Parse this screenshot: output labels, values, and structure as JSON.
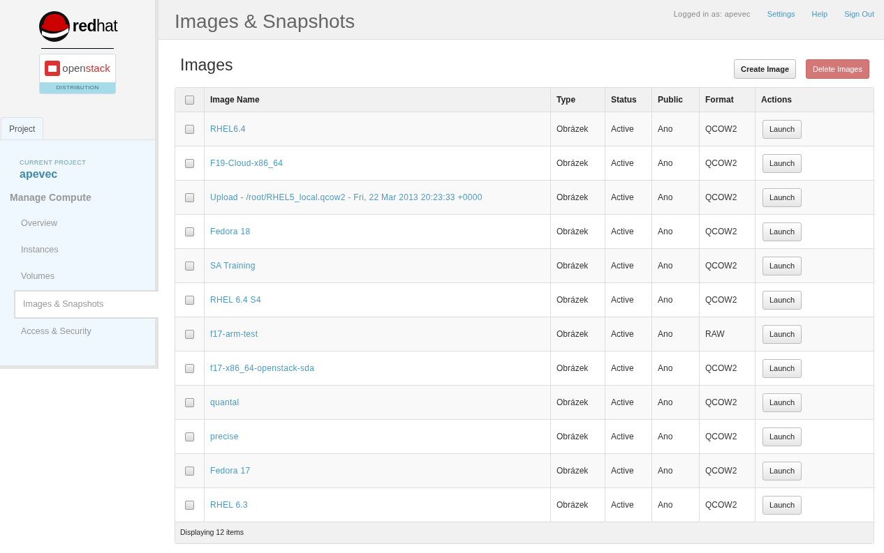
{
  "brand": {
    "logo_text_bold": "red",
    "logo_text": "hat",
    "sub_logo_left": "open",
    "sub_logo_right": "stack",
    "sub_logo_banner": "DISTRIBUTION"
  },
  "sidebar": {
    "tabs": [
      {
        "label": "Project",
        "selected": true
      }
    ],
    "current_project_label": "CURRENT PROJECT",
    "current_project": "apevec",
    "section": "Manage Compute",
    "items": [
      {
        "label": "Overview",
        "selected": false
      },
      {
        "label": "Instances",
        "selected": false
      },
      {
        "label": "Volumes",
        "selected": false
      },
      {
        "label": "Images & Snapshots",
        "selected": true
      },
      {
        "label": "Access & Security",
        "selected": false
      }
    ]
  },
  "header": {
    "title": "Images & Snapshots",
    "logged_in": "Logged in as: apevec",
    "links": [
      "Settings",
      "Help",
      "Sign Out"
    ]
  },
  "panel": {
    "title": "Images",
    "buttons": [
      {
        "label": "Create Image",
        "kind": "default"
      },
      {
        "label": "Delete Images",
        "kind": "danger"
      }
    ]
  },
  "table": {
    "columns": [
      "Image Name",
      "Type",
      "Status",
      "Public",
      "Format",
      "Actions"
    ],
    "select_all_checked": false,
    "rows": [
      {
        "name": "RHEL6.4",
        "type": "Obrázek",
        "status": "Active",
        "public": "Ano",
        "format": "QCOW2",
        "action": "Launch",
        "checked": false
      },
      {
        "name": "F19-Cloud-x86_64",
        "type": "Obrázek",
        "status": "Active",
        "public": "Ano",
        "format": "QCOW2",
        "action": "Launch",
        "checked": false
      },
      {
        "name": "Upload - /root/RHEL5_local.qcow2 - Fri, 22 Mar 2013 20:23:33 +0000",
        "type": "Obrázek",
        "status": "Active",
        "public": "Ano",
        "format": "QCOW2",
        "action": "Launch",
        "checked": false
      },
      {
        "name": "Fedora 18",
        "type": "Obrázek",
        "status": "Active",
        "public": "Ano",
        "format": "QCOW2",
        "action": "Launch",
        "checked": false
      },
      {
        "name": "SA Training",
        "type": "Obrázek",
        "status": "Active",
        "public": "Ano",
        "format": "QCOW2",
        "action": "Launch",
        "checked": false
      },
      {
        "name": "RHEL 6.4 S4",
        "type": "Obrázek",
        "status": "Active",
        "public": "Ano",
        "format": "QCOW2",
        "action": "Launch",
        "checked": false
      },
      {
        "name": "f17-arm-test",
        "type": "Obrázek",
        "status": "Active",
        "public": "Ano",
        "format": "RAW",
        "action": "Launch",
        "checked": false
      },
      {
        "name": "f17-x86_64-openstack-sda",
        "type": "Obrázek",
        "status": "Active",
        "public": "Ano",
        "format": "QCOW2",
        "action": "Launch",
        "checked": false
      },
      {
        "name": "quantal",
        "type": "Obrázek",
        "status": "Active",
        "public": "Ano",
        "format": "QCOW2",
        "action": "Launch",
        "checked": false
      },
      {
        "name": "precise",
        "type": "Obrázek",
        "status": "Active",
        "public": "Ano",
        "format": "QCOW2",
        "action": "Launch",
        "checked": false
      },
      {
        "name": "Fedora 17",
        "type": "Obrázek",
        "status": "Active",
        "public": "Ano",
        "format": "QCOW2",
        "action": "Launch",
        "checked": false
      },
      {
        "name": "RHEL 6.3",
        "type": "Obrázek",
        "status": "Active",
        "public": "Ano",
        "format": "QCOW2",
        "action": "Launch",
        "checked": false
      }
    ],
    "footer": "Displaying 12 items"
  }
}
